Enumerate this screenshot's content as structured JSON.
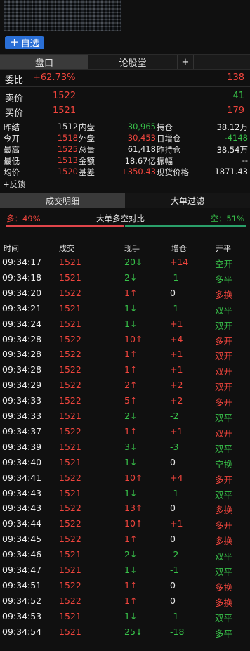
{
  "header": {
    "add_label": "自选",
    "plus_glyph": "+"
  },
  "tabs": {
    "pankou": "盘口",
    "forum": "论股堂",
    "add_glyph": "+"
  },
  "quote": {
    "weibi_label": "委比",
    "weibi_value": "+62.73%",
    "weibi_qty": "138",
    "sell_label": "卖价",
    "sell_price": "1522",
    "sell_qty": "41",
    "buy_label": "买价",
    "buy_price": "1521",
    "buy_qty": "179"
  },
  "stats": [
    {
      "l1": "昨结",
      "v1": "1512",
      "v1c": "white",
      "l2": "内盘",
      "v2": "30,965",
      "v2c": "green",
      "l3": "持仓",
      "v3": "38.12万",
      "v3c": "white"
    },
    {
      "l1": "今开",
      "v1": "1518",
      "v1c": "red",
      "l2": "外盘",
      "v2": "30,453",
      "v2c": "red",
      "l3": "日增仓",
      "v3": "-4148",
      "v3c": "green"
    },
    {
      "l1": "最高",
      "v1": "1525",
      "v1c": "red",
      "l2": "总量",
      "v2": "61,418",
      "v2c": "white",
      "l3": "昨持仓",
      "v3": "38.54万",
      "v3c": "white"
    },
    {
      "l1": "最低",
      "v1": "1513",
      "v1c": "red",
      "l2": "金额",
      "v2": "18.67亿",
      "v2c": "white",
      "l3": "振幅",
      "v3": "--",
      "v3c": "white"
    },
    {
      "l1": "均价",
      "v1": "1520",
      "v1c": "red",
      "l2": "基差",
      "v2": "+350.43",
      "v2c": "red",
      "l3": "现货价格",
      "v3": "1871.43",
      "v3c": "white"
    }
  ],
  "feedback": "+反馈",
  "detail_tabs": {
    "trades": "成交明细",
    "filter": "大单过滤"
  },
  "ratio": {
    "long": "多：49%",
    "title": "大单多空对比",
    "short": "空：51%",
    "long_pct": 49,
    "short_pct": 51
  },
  "table": {
    "headers": [
      "时间",
      "成交",
      "现手",
      "增仓",
      "开平"
    ],
    "rows": [
      {
        "time": "09:34:17",
        "price": "1521",
        "pc": "red",
        "vol": "20↓",
        "vc": "green",
        "oi": "+14",
        "oc": "red",
        "type": "空开",
        "tc": "green"
      },
      {
        "time": "09:34:18",
        "price": "1521",
        "pc": "red",
        "vol": "2↓",
        "vc": "green",
        "oi": "-1",
        "oc": "green",
        "type": "多平",
        "tc": "green"
      },
      {
        "time": "09:34:20",
        "price": "1522",
        "pc": "red",
        "vol": "1↑",
        "vc": "red",
        "oi": "0",
        "oc": "white",
        "type": "多换",
        "tc": "red"
      },
      {
        "time": "09:34:21",
        "price": "1521",
        "pc": "red",
        "vol": "1↓",
        "vc": "green",
        "oi": "-1",
        "oc": "green",
        "type": "双平",
        "tc": "green"
      },
      {
        "time": "09:34:24",
        "price": "1521",
        "pc": "red",
        "vol": "1↓",
        "vc": "green",
        "oi": "+1",
        "oc": "red",
        "type": "双开",
        "tc": "green"
      },
      {
        "time": "09:34:28",
        "price": "1522",
        "pc": "red",
        "vol": "10↑",
        "vc": "red",
        "oi": "+4",
        "oc": "red",
        "type": "多开",
        "tc": "red"
      },
      {
        "time": "09:34:28",
        "price": "1522",
        "pc": "red",
        "vol": "1↑",
        "vc": "red",
        "oi": "+1",
        "oc": "red",
        "type": "双开",
        "tc": "red"
      },
      {
        "time": "09:34:28",
        "price": "1522",
        "pc": "red",
        "vol": "1↑",
        "vc": "red",
        "oi": "+1",
        "oc": "red",
        "type": "双开",
        "tc": "red"
      },
      {
        "time": "09:34:29",
        "price": "1522",
        "pc": "red",
        "vol": "2↑",
        "vc": "red",
        "oi": "+2",
        "oc": "red",
        "type": "双开",
        "tc": "red"
      },
      {
        "time": "09:34:33",
        "price": "1522",
        "pc": "red",
        "vol": "5↑",
        "vc": "red",
        "oi": "+2",
        "oc": "red",
        "type": "多开",
        "tc": "red"
      },
      {
        "time": "09:34:33",
        "price": "1521",
        "pc": "red",
        "vol": "2↓",
        "vc": "green",
        "oi": "-2",
        "oc": "green",
        "type": "双平",
        "tc": "green"
      },
      {
        "time": "09:34:37",
        "price": "1522",
        "pc": "red",
        "vol": "1↑",
        "vc": "red",
        "oi": "+1",
        "oc": "red",
        "type": "双开",
        "tc": "red"
      },
      {
        "time": "09:34:39",
        "price": "1521",
        "pc": "red",
        "vol": "3↓",
        "vc": "green",
        "oi": "-3",
        "oc": "green",
        "type": "双平",
        "tc": "green"
      },
      {
        "time": "09:34:40",
        "price": "1521",
        "pc": "red",
        "vol": "1↓",
        "vc": "green",
        "oi": "0",
        "oc": "white",
        "type": "空换",
        "tc": "green"
      },
      {
        "time": "09:34:41",
        "price": "1522",
        "pc": "red",
        "vol": "10↑",
        "vc": "red",
        "oi": "+4",
        "oc": "red",
        "type": "多开",
        "tc": "red"
      },
      {
        "time": "09:34:43",
        "price": "1521",
        "pc": "red",
        "vol": "1↓",
        "vc": "green",
        "oi": "-1",
        "oc": "green",
        "type": "双平",
        "tc": "green"
      },
      {
        "time": "09:34:43",
        "price": "1522",
        "pc": "red",
        "vol": "13↑",
        "vc": "red",
        "oi": "0",
        "oc": "white",
        "type": "多换",
        "tc": "red"
      },
      {
        "time": "09:34:44",
        "price": "1522",
        "pc": "red",
        "vol": "10↑",
        "vc": "red",
        "oi": "+1",
        "oc": "red",
        "type": "多开",
        "tc": "red"
      },
      {
        "time": "09:34:45",
        "price": "1522",
        "pc": "red",
        "vol": "1↑",
        "vc": "red",
        "oi": "0",
        "oc": "white",
        "type": "多换",
        "tc": "red"
      },
      {
        "time": "09:34:46",
        "price": "1521",
        "pc": "red",
        "vol": "2↓",
        "vc": "green",
        "oi": "-2",
        "oc": "green",
        "type": "双平",
        "tc": "green"
      },
      {
        "time": "09:34:47",
        "price": "1521",
        "pc": "red",
        "vol": "1↓",
        "vc": "green",
        "oi": "-1",
        "oc": "green",
        "type": "双平",
        "tc": "green"
      },
      {
        "time": "09:34:51",
        "price": "1522",
        "pc": "red",
        "vol": "1↑",
        "vc": "red",
        "oi": "0",
        "oc": "white",
        "type": "多换",
        "tc": "red"
      },
      {
        "time": "09:34:52",
        "price": "1522",
        "pc": "red",
        "vol": "1↑",
        "vc": "red",
        "oi": "0",
        "oc": "white",
        "type": "多换",
        "tc": "red"
      },
      {
        "time": "09:34:53",
        "price": "1521",
        "pc": "red",
        "vol": "1↓",
        "vc": "green",
        "oi": "-1",
        "oc": "green",
        "type": "双平",
        "tc": "green"
      },
      {
        "time": "09:34:54",
        "price": "1521",
        "pc": "red",
        "vol": "25↓",
        "vc": "green",
        "oi": "-18",
        "oc": "green",
        "type": "多平",
        "tc": "green"
      }
    ]
  },
  "colors": {
    "up": "#f0453d",
    "down": "#38c24a",
    "accent": "#2a6fd6",
    "background": "#101010"
  }
}
